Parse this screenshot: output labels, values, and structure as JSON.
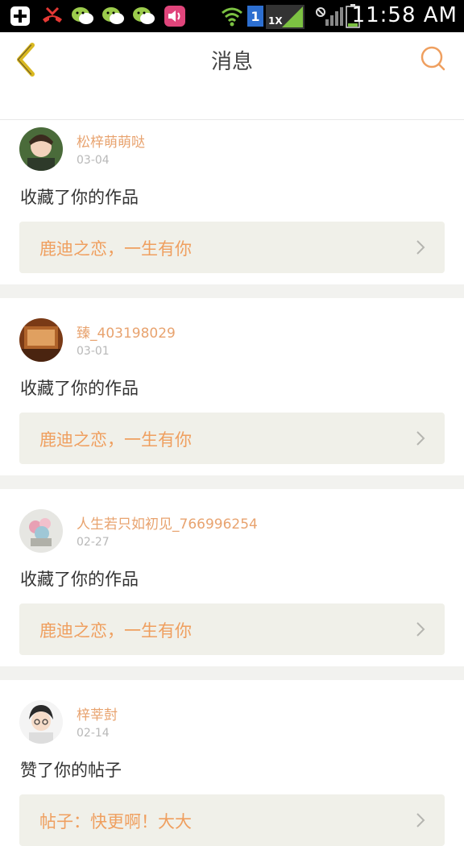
{
  "status": {
    "time": "11:58 AM",
    "network_badge": "1",
    "rate_badge": "1X"
  },
  "header": {
    "title": "消息"
  },
  "items": [
    {
      "username": "松梓萌萌哒",
      "date": "03-04",
      "action": "收藏了你的作品",
      "work": "鹿迪之恋，一生有你"
    },
    {
      "username": "臻_403198029",
      "date": "03-01",
      "action": "收藏了你的作品",
      "work": "鹿迪之恋，一生有你"
    },
    {
      "username": "人生若只如初见_766996254",
      "date": "02-27",
      "action": "收藏了你的作品",
      "work": "鹿迪之恋，一生有你"
    },
    {
      "username": "梓莘尌",
      "date": "02-14",
      "action": "赞了你的帖子",
      "work": "帖子：快更啊！大大"
    }
  ],
  "colors": {
    "accent": "#ef9f5f",
    "username": "#e8a36f",
    "back_arrow": "#d9b820",
    "card_bg": "#f0f0e9"
  }
}
